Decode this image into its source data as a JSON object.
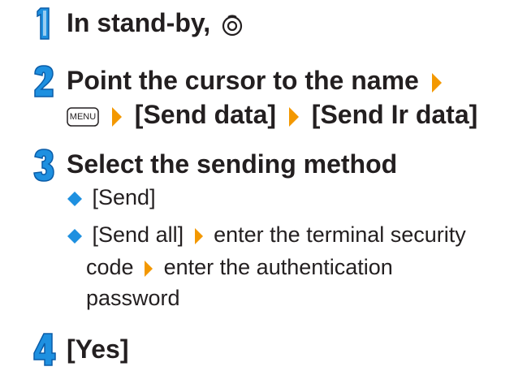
{
  "colors": {
    "accent_blue": "#1e90e0",
    "accent_blue_dark": "#0a5ca8",
    "arrow_orange": "#f39800",
    "text": "#231f20"
  },
  "step1": {
    "number": "1",
    "text": "In stand-by,",
    "key_icon": "dial-center-key-icon"
  },
  "step2": {
    "number": "2",
    "line1": "Point the cursor to the name",
    "menu_key": "MENU",
    "item1": "[Send data]",
    "item2": "[Send Ir data]"
  },
  "step3": {
    "number": "3",
    "title": "Select the sending method",
    "opt1": "[Send]",
    "opt2": "[Send all]",
    "opt2_a": "enter the terminal security",
    "opt2_b": "code",
    "opt2_c": "enter the authentication",
    "opt2_d": "password"
  },
  "step4": {
    "number": "4",
    "text": "[Yes]"
  }
}
